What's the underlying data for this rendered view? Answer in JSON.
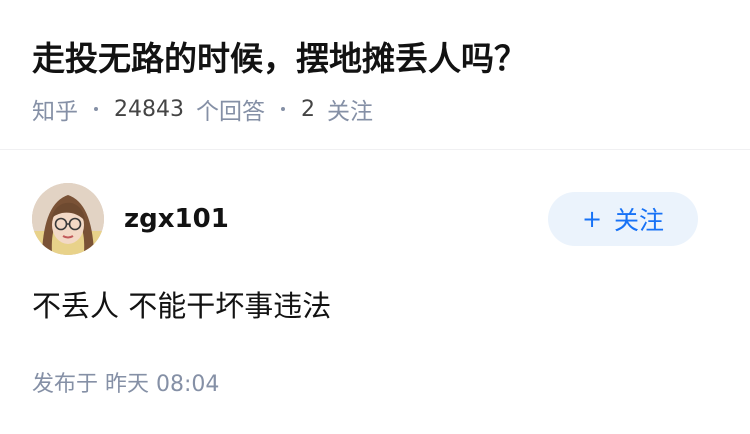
{
  "question": {
    "title": "走投无路的时候，摆地摊丢人吗？",
    "source": "知乎",
    "answer_count": "24843",
    "answer_label": "个回答",
    "follow_count": "2",
    "follow_label": "关注"
  },
  "author": {
    "name": "zgx101",
    "follow_button_icon": "+",
    "follow_button_label": "关注"
  },
  "answer": {
    "content": "不丢人 不能干坏事违法",
    "published_label": "发布于",
    "published_time": "昨天 08:04"
  },
  "colors": {
    "title": "#121212",
    "meta": "#8590a6",
    "accent": "#1772f6",
    "follow_bg": "#ebf3fc"
  },
  "icons": {
    "follow": "plus-icon",
    "avatar": "user-avatar-photo"
  }
}
